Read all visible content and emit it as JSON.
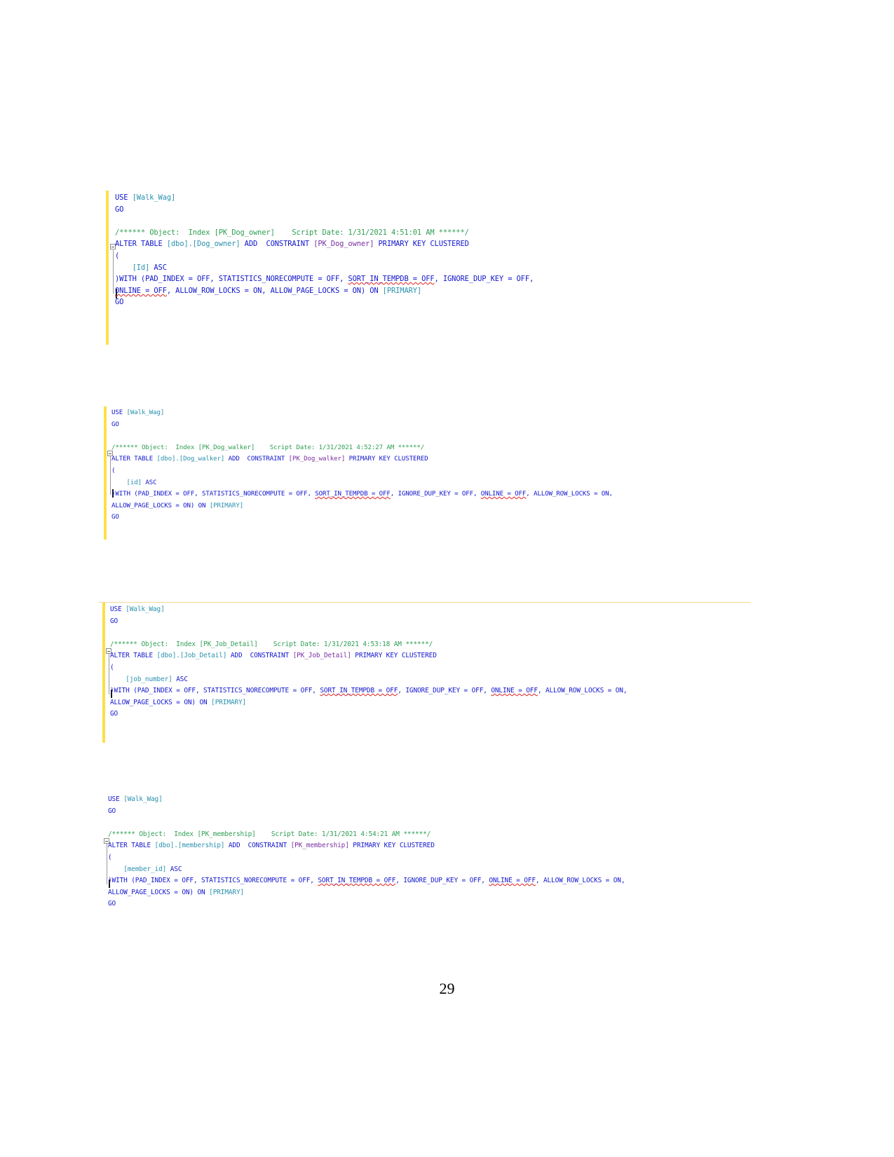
{
  "document": {
    "page_number": "29",
    "background_color": "#ffffff"
  },
  "theme": {
    "keyword_color": "#1115cc",
    "identifier_color": "#2b91af",
    "comment_color": "#2e9e52",
    "constraint_color": "#7b2fa0",
    "change_bar_color": "#fbe04a",
    "spellcheck_underline_color": "#e02020"
  },
  "code_blocks": [
    {
      "id": "block-dog-owner",
      "object_name": "PK_Dog_owner",
      "table": "[dbo].[Dog_owner]",
      "script_date": "1/31/2021 4:51:01 AM",
      "database": "[Walk_Wag]",
      "key_column": "[Id]",
      "lines": [
        {
          "id": "l1",
          "segments": [
            {
              "t": "USE ",
              "c": "kw"
            },
            {
              "t": "[Walk_Wag]",
              "c": "obj"
            }
          ]
        },
        {
          "id": "l2",
          "segments": [
            {
              "t": "GO",
              "c": "kw"
            }
          ]
        },
        {
          "id": "l3",
          "segments": [
            {
              "t": "",
              "c": "pln"
            }
          ]
        },
        {
          "id": "l4",
          "segments": [
            {
              "t": "/****** Object:  Index [PK_Dog_owner]    Script Date: 1/31/2021 4:51:01 AM ******/",
              "c": "cmt"
            }
          ]
        },
        {
          "id": "l5",
          "segments": [
            {
              "t": "ALTER TABLE ",
              "c": "kw"
            },
            {
              "t": "[dbo].[Dog_owner]",
              "c": "obj"
            },
            {
              "t": " ADD  CONSTRAINT ",
              "c": "kw"
            },
            {
              "t": "[PK_Dog_owner]",
              "c": "pur"
            },
            {
              "t": " PRIMARY KEY CLUSTERED",
              "c": "kw"
            }
          ]
        },
        {
          "id": "l6",
          "segments": [
            {
              "t": "(",
              "c": "kw"
            }
          ]
        },
        {
          "id": "l7",
          "segments": [
            {
              "t": "    ",
              "c": "pln"
            },
            {
              "t": "[Id]",
              "c": "obj"
            },
            {
              "t": " ASC",
              "c": "kw"
            }
          ]
        },
        {
          "id": "l8",
          "segments": [
            {
              "t": ")WITH (PAD_INDEX = OFF, STATISTICS_NORECOMPUTE = OFF, ",
              "c": "kw"
            },
            {
              "t": "SORT_IN_TEMPDB = OFF",
              "c": "kw sq"
            },
            {
              "t": ", IGNORE_DUP_KEY = OFF,",
              "c": "kw"
            }
          ]
        },
        {
          "id": "l9",
          "segments": [
            {
              "t": "ONLINE = OFF",
              "c": "kw sq"
            },
            {
              "t": ", ALLOW_ROW_LOCKS = ON, ALLOW_PAGE_LOCKS = ON) ON ",
              "c": "kw"
            },
            {
              "t": "[PRIMARY]",
              "c": "obj"
            }
          ]
        },
        {
          "id": "l10",
          "segments": [
            {
              "t": "GO",
              "c": "kw"
            }
          ]
        }
      ]
    },
    {
      "id": "block-dog-walker",
      "object_name": "PK_Dog_walker",
      "table": "[dbo].[Dog_walker]",
      "script_date": "1/31/2021 4:52:27 AM",
      "database": "[Walk_Wag]",
      "key_column": "[id]",
      "lines": [
        {
          "id": "l1",
          "segments": [
            {
              "t": "USE ",
              "c": "kw"
            },
            {
              "t": "[Walk_Wag]",
              "c": "obj"
            }
          ]
        },
        {
          "id": "l2",
          "segments": [
            {
              "t": "GO",
              "c": "kw"
            }
          ]
        },
        {
          "id": "l3",
          "segments": [
            {
              "t": "",
              "c": "pln"
            }
          ]
        },
        {
          "id": "l4",
          "segments": [
            {
              "t": "/****** Object:  Index [PK_Dog_walker]    Script Date: 1/31/2021 4:52:27 AM ******/",
              "c": "cmt"
            }
          ]
        },
        {
          "id": "l5",
          "segments": [
            {
              "t": "ALTER TABLE ",
              "c": "kw"
            },
            {
              "t": "[dbo].[Dog_walker]",
              "c": "obj"
            },
            {
              "t": " ADD  CONSTRAINT ",
              "c": "kw"
            },
            {
              "t": "[PK_Dog_walker]",
              "c": "pur"
            },
            {
              "t": " PRIMARY KEY CLUSTERED",
              "c": "kw"
            }
          ]
        },
        {
          "id": "l6",
          "segments": [
            {
              "t": "(",
              "c": "kw"
            }
          ]
        },
        {
          "id": "l7",
          "segments": [
            {
              "t": "    ",
              "c": "pln"
            },
            {
              "t": "[id]",
              "c": "obj"
            },
            {
              "t": " ASC",
              "c": "kw"
            }
          ]
        },
        {
          "id": "l8",
          "segments": [
            {
              "t": ")WITH (PAD_INDEX = OFF, STATISTICS_NORECOMPUTE = OFF, ",
              "c": "kw"
            },
            {
              "t": "SORT_IN_TEMPDB = OFF",
              "c": "kw sq"
            },
            {
              "t": ", IGNORE_DUP_KEY = OFF, ",
              "c": "kw"
            },
            {
              "t": "ONLINE = OFF",
              "c": "kw sq"
            },
            {
              "t": ", ALLOW_ROW_LOCKS = ON,",
              "c": "kw"
            }
          ]
        },
        {
          "id": "l9",
          "segments": [
            {
              "t": "ALLOW_PAGE_LOCKS = ON) ON ",
              "c": "kw"
            },
            {
              "t": "[PRIMARY]",
              "c": "obj"
            }
          ]
        },
        {
          "id": "l10",
          "segments": [
            {
              "t": "GO",
              "c": "kw"
            }
          ]
        }
      ]
    },
    {
      "id": "block-job-detail",
      "object_name": "PK_Job_Detail",
      "table": "[dbo].[Job_Detail]",
      "script_date": "1/31/2021 4:53:18 AM",
      "database": "[Walk_Wag]",
      "key_column": "[job_number]",
      "lines": [
        {
          "id": "l1",
          "segments": [
            {
              "t": "USE ",
              "c": "kw"
            },
            {
              "t": "[Walk_Wag]",
              "c": "obj"
            }
          ]
        },
        {
          "id": "l2",
          "segments": [
            {
              "t": "GO",
              "c": "kw"
            }
          ]
        },
        {
          "id": "l3",
          "segments": [
            {
              "t": "",
              "c": "pln"
            }
          ]
        },
        {
          "id": "l4",
          "segments": [
            {
              "t": "/****** Object:  Index [PK_Job_Detail]    Script Date: 1/31/2021 4:53:18 AM ******/",
              "c": "cmt"
            }
          ]
        },
        {
          "id": "l5",
          "segments": [
            {
              "t": "ALTER TABLE ",
              "c": "kw"
            },
            {
              "t": "[dbo].[Job_Detail]",
              "c": "obj"
            },
            {
              "t": " ADD  CONSTRAINT ",
              "c": "kw"
            },
            {
              "t": "[PK_Job_Detail]",
              "c": "pur"
            },
            {
              "t": " PRIMARY KEY CLUSTERED",
              "c": "kw"
            }
          ]
        },
        {
          "id": "l6",
          "segments": [
            {
              "t": "(",
              "c": "kw"
            }
          ]
        },
        {
          "id": "l7",
          "segments": [
            {
              "t": "    ",
              "c": "pln"
            },
            {
              "t": "[job_number]",
              "c": "obj"
            },
            {
              "t": " ASC",
              "c": "kw"
            }
          ]
        },
        {
          "id": "l8",
          "segments": [
            {
              "t": ")WITH (PAD_INDEX = OFF, STATISTICS_NORECOMPUTE = OFF, ",
              "c": "kw"
            },
            {
              "t": "SORT_IN_TEMPDB = OFF",
              "c": "kw sq"
            },
            {
              "t": ", IGNORE_DUP_KEY = OFF, ",
              "c": "kw"
            },
            {
              "t": "ONLINE = OFF",
              "c": "kw sq"
            },
            {
              "t": ", ALLOW_ROW_LOCKS = ON,",
              "c": "kw"
            }
          ]
        },
        {
          "id": "l9",
          "segments": [
            {
              "t": "ALLOW_PAGE_LOCKS = ON) ON ",
              "c": "kw"
            },
            {
              "t": "[PRIMARY]",
              "c": "obj"
            }
          ]
        },
        {
          "id": "l10",
          "segments": [
            {
              "t": "GO",
              "c": "kw"
            }
          ]
        }
      ]
    },
    {
      "id": "block-membership",
      "object_name": "PK_membership",
      "table": "[dbo].[membership]",
      "script_date": "1/31/2021 4:54:21 AM",
      "database": "[Walk_Wag]",
      "key_column": "[member_id]",
      "lines": [
        {
          "id": "l1",
          "segments": [
            {
              "t": "USE ",
              "c": "kw"
            },
            {
              "t": "[Walk_Wag]",
              "c": "obj"
            }
          ]
        },
        {
          "id": "l2",
          "segments": [
            {
              "t": "GO",
              "c": "kw"
            }
          ]
        },
        {
          "id": "l3",
          "segments": [
            {
              "t": "",
              "c": "pln"
            }
          ]
        },
        {
          "id": "l4",
          "segments": [
            {
              "t": "/****** Object:  Index [PK_membership]    Script Date: 1/31/2021 4:54:21 AM ******/",
              "c": "cmt"
            }
          ]
        },
        {
          "id": "l5",
          "segments": [
            {
              "t": "ALTER TABLE ",
              "c": "kw"
            },
            {
              "t": "[dbo].[membership]",
              "c": "obj"
            },
            {
              "t": " ADD  CONSTRAINT ",
              "c": "kw"
            },
            {
              "t": "[PK_membership]",
              "c": "pur"
            },
            {
              "t": " PRIMARY KEY CLUSTERED",
              "c": "kw"
            }
          ]
        },
        {
          "id": "l6",
          "segments": [
            {
              "t": "(",
              "c": "kw"
            }
          ]
        },
        {
          "id": "l7",
          "segments": [
            {
              "t": "    ",
              "c": "pln"
            },
            {
              "t": "[member_id]",
              "c": "obj"
            },
            {
              "t": " ASC",
              "c": "kw"
            }
          ]
        },
        {
          "id": "l8",
          "segments": [
            {
              "t": ")WITH (PAD_INDEX = OFF, STATISTICS_NORECOMPUTE = OFF, ",
              "c": "kw"
            },
            {
              "t": "SORT_IN_TEMPDB = OFF",
              "c": "kw sq"
            },
            {
              "t": ", IGNORE_DUP_KEY = OFF, ",
              "c": "kw"
            },
            {
              "t": "ONLINE = OFF",
              "c": "kw sq"
            },
            {
              "t": ", ALLOW_ROW_LOCKS = ON,",
              "c": "kw"
            }
          ]
        },
        {
          "id": "l9",
          "segments": [
            {
              "t": "ALLOW_PAGE_LOCKS = ON) ON ",
              "c": "kw"
            },
            {
              "t": "[PRIMARY]",
              "c": "obj"
            }
          ]
        },
        {
          "id": "l10",
          "segments": [
            {
              "t": "GO",
              "c": "kw"
            }
          ]
        }
      ]
    }
  ]
}
